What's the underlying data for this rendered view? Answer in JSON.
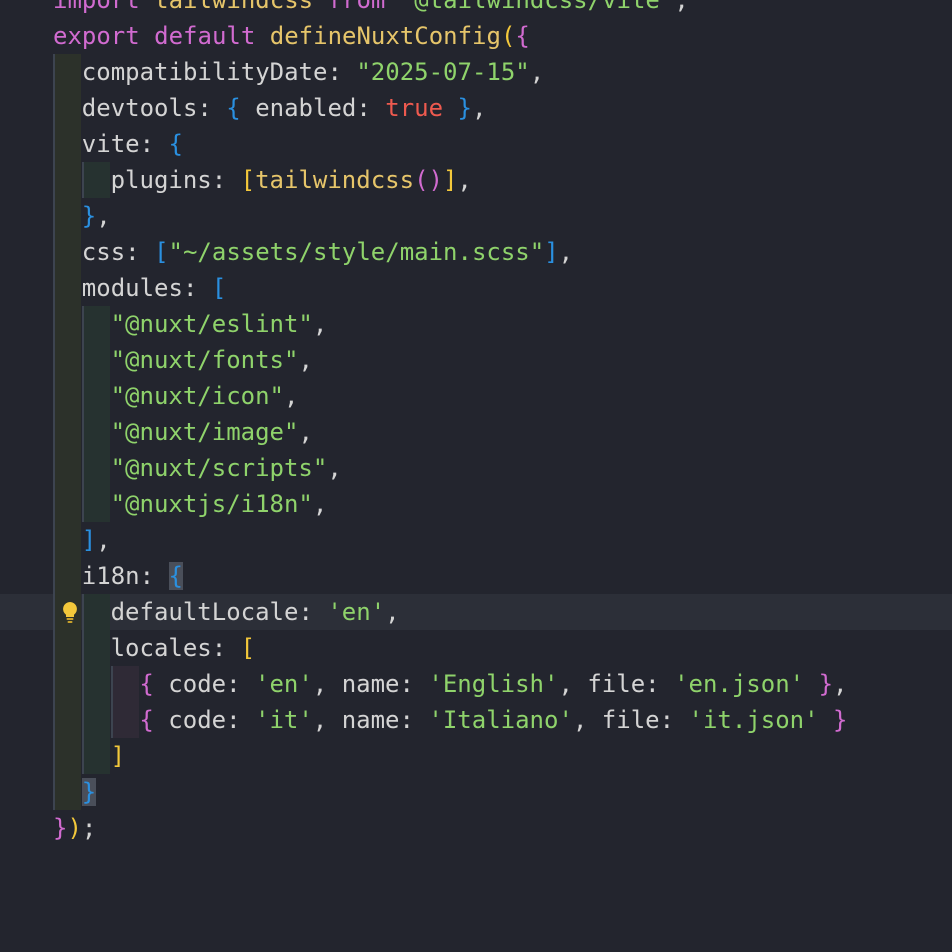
{
  "editor": {
    "language": "typescript",
    "lines": [
      {
        "tokens": [
          {
            "t": "import",
            "c": "kw"
          },
          {
            "t": " tailwindcss ",
            "c": "fn"
          },
          {
            "t": "from",
            "c": "kw"
          },
          {
            "t": " \"@tailwindcss/vite\"",
            "c": "str"
          },
          {
            "t": ";",
            "c": "punc"
          }
        ]
      },
      {
        "tokens": [
          {
            "t": "export",
            "c": "kw"
          },
          {
            "t": " ",
            "c": "punc"
          },
          {
            "t": "default",
            "c": "kw"
          },
          {
            "t": " ",
            "c": "punc"
          },
          {
            "t": "defineNuxtConfig",
            "c": "fn"
          },
          {
            "t": "(",
            "c": "br-y"
          },
          {
            "t": "{",
            "c": "br-p"
          }
        ]
      },
      {
        "tokens": [
          {
            "t": "compatibilityDate",
            "c": "prop"
          },
          {
            "t": ": ",
            "c": "punc"
          },
          {
            "t": "\"2025-07-15\"",
            "c": "str"
          },
          {
            "t": ",",
            "c": "punc"
          }
        ]
      },
      {
        "tokens": [
          {
            "t": "devtools",
            "c": "prop"
          },
          {
            "t": ": ",
            "c": "punc"
          },
          {
            "t": "{",
            "c": "br-b"
          },
          {
            "t": " enabled",
            "c": "prop"
          },
          {
            "t": ": ",
            "c": "punc"
          },
          {
            "t": "true",
            "c": "bool"
          },
          {
            "t": " ",
            "c": "punc"
          },
          {
            "t": "}",
            "c": "br-b"
          },
          {
            "t": ",",
            "c": "punc"
          }
        ]
      },
      {
        "tokens": [
          {
            "t": "vite",
            "c": "prop"
          },
          {
            "t": ": ",
            "c": "punc"
          },
          {
            "t": "{",
            "c": "br-b"
          }
        ]
      },
      {
        "tokens": [
          {
            "t": "plugins",
            "c": "prop"
          },
          {
            "t": ": ",
            "c": "punc"
          },
          {
            "t": "[",
            "c": "br-y"
          },
          {
            "t": "tailwindcss",
            "c": "fn"
          },
          {
            "t": "()",
            "c": "br-p"
          },
          {
            "t": "]",
            "c": "br-y"
          },
          {
            "t": ",",
            "c": "punc"
          }
        ]
      },
      {
        "tokens": [
          {
            "t": "}",
            "c": "br-b"
          },
          {
            "t": ",",
            "c": "punc"
          }
        ]
      },
      {
        "tokens": [
          {
            "t": "css",
            "c": "prop"
          },
          {
            "t": ": ",
            "c": "punc"
          },
          {
            "t": "[",
            "c": "br-b"
          },
          {
            "t": "\"~/assets/style/main.scss\"",
            "c": "str"
          },
          {
            "t": "]",
            "c": "br-b"
          },
          {
            "t": ",",
            "c": "punc"
          }
        ]
      },
      {
        "tokens": [
          {
            "t": "modules",
            "c": "prop"
          },
          {
            "t": ": ",
            "c": "punc"
          },
          {
            "t": "[",
            "c": "br-b"
          }
        ]
      },
      {
        "tokens": [
          {
            "t": "\"@nuxt/eslint\"",
            "c": "str"
          },
          {
            "t": ",",
            "c": "punc"
          }
        ]
      },
      {
        "tokens": [
          {
            "t": "\"@nuxt/fonts\"",
            "c": "str"
          },
          {
            "t": ",",
            "c": "punc"
          }
        ]
      },
      {
        "tokens": [
          {
            "t": "\"@nuxt/icon\"",
            "c": "str"
          },
          {
            "t": ",",
            "c": "punc"
          }
        ]
      },
      {
        "tokens": [
          {
            "t": "\"@nuxt/image\"",
            "c": "str"
          },
          {
            "t": ",",
            "c": "punc"
          }
        ]
      },
      {
        "tokens": [
          {
            "t": "\"@nuxt/scripts\"",
            "c": "str"
          },
          {
            "t": ",",
            "c": "punc"
          }
        ]
      },
      {
        "tokens": [
          {
            "t": "\"@nuxtjs/i18n\"",
            "c": "str"
          },
          {
            "t": ",",
            "c": "punc"
          }
        ]
      },
      {
        "tokens": [
          {
            "t": "]",
            "c": "br-b"
          },
          {
            "t": ",",
            "c": "punc"
          }
        ]
      },
      {
        "tokens": [
          {
            "t": "i18n",
            "c": "prop"
          },
          {
            "t": ": ",
            "c": "punc"
          },
          {
            "t": "{",
            "c": "br-b",
            "match": true
          }
        ]
      },
      {
        "tokens": [
          {
            "t": "defaultLocale",
            "c": "prop"
          },
          {
            "t": ": ",
            "c": "punc"
          },
          {
            "t": "'en'",
            "c": "str"
          },
          {
            "t": ",",
            "c": "punc"
          }
        ]
      },
      {
        "tokens": [
          {
            "t": "locales",
            "c": "prop"
          },
          {
            "t": ": ",
            "c": "punc"
          },
          {
            "t": "[",
            "c": "br-y"
          }
        ]
      },
      {
        "tokens": [
          {
            "t": "{",
            "c": "br-p"
          },
          {
            "t": " code",
            "c": "prop"
          },
          {
            "t": ": ",
            "c": "punc"
          },
          {
            "t": "'en'",
            "c": "str"
          },
          {
            "t": ", name",
            "c": "prop"
          },
          {
            "t": ": ",
            "c": "punc"
          },
          {
            "t": "'English'",
            "c": "str"
          },
          {
            "t": ", file",
            "c": "prop"
          },
          {
            "t": ": ",
            "c": "punc"
          },
          {
            "t": "'en.json'",
            "c": "str"
          },
          {
            "t": " ",
            "c": "punc"
          },
          {
            "t": "}",
            "c": "br-p"
          },
          {
            "t": ",",
            "c": "punc"
          }
        ]
      },
      {
        "tokens": [
          {
            "t": "{",
            "c": "br-p"
          },
          {
            "t": " code",
            "c": "prop"
          },
          {
            "t": ": ",
            "c": "punc"
          },
          {
            "t": "'it'",
            "c": "str"
          },
          {
            "t": ", name",
            "c": "prop"
          },
          {
            "t": ": ",
            "c": "punc"
          },
          {
            "t": "'Italiano'",
            "c": "str"
          },
          {
            "t": ", file",
            "c": "prop"
          },
          {
            "t": ": ",
            "c": "punc"
          },
          {
            "t": "'it.json'",
            "c": "str"
          },
          {
            "t": " ",
            "c": "punc"
          },
          {
            "t": "}",
            "c": "br-p"
          }
        ]
      },
      {
        "tokens": [
          {
            "t": "]",
            "c": "br-y"
          }
        ]
      },
      {
        "tokens": [
          {
            "t": "}",
            "c": "br-b",
            "match": true
          }
        ]
      },
      {
        "tokens": [
          {
            "t": "}",
            "c": "br-p"
          },
          {
            "t": ")",
            "c": "br-y"
          },
          {
            "t": ";",
            "c": "punc"
          }
        ]
      }
    ],
    "indent_levels": [
      0,
      0,
      1,
      1,
      1,
      2,
      1,
      1,
      1,
      2,
      2,
      2,
      2,
      2,
      2,
      1,
      1,
      2,
      2,
      3,
      3,
      2,
      1,
      0
    ],
    "current_line_index": 17,
    "lightbulb_icon": "lightbulb-icon"
  }
}
